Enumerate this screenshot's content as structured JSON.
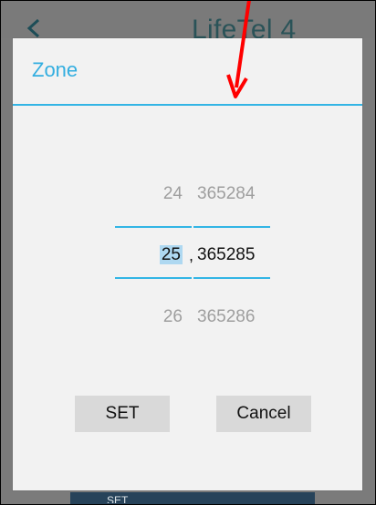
{
  "app": {
    "title": "LifeTel 4",
    "bottom_button_label": "SET"
  },
  "dialog": {
    "title": "Zone",
    "picker_left": {
      "prev": "24",
      "current": "25",
      "next": "26"
    },
    "separator": ",",
    "picker_right": {
      "prev": "365284",
      "current": "365285",
      "next": "365286"
    },
    "buttons": {
      "set": "SET",
      "cancel": "Cancel"
    }
  },
  "colors": {
    "accent": "#33b5e5",
    "annotation_arrow": "#ff0000"
  },
  "icons": {
    "back": "back-arrow-icon",
    "annotation": "red-arrow-icon"
  }
}
